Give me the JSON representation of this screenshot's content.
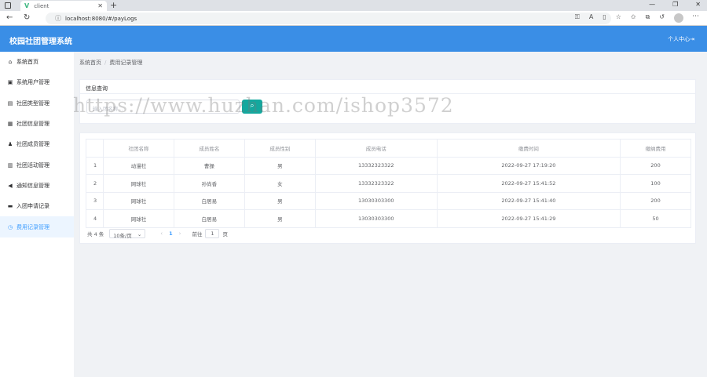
{
  "browser": {
    "tab_title": "client",
    "url": "localhost:8080/#/payLogs"
  },
  "header": {
    "title": "校园社团管理系统",
    "user_center": "个人中心"
  },
  "sidebar": {
    "items": [
      {
        "label": "系统首页",
        "icon": "home-icon"
      },
      {
        "label": "系统用户管理",
        "icon": "user-icon"
      },
      {
        "label": "社团类型管理",
        "icon": "list-icon"
      },
      {
        "label": "社团信息管理",
        "icon": "building-icon"
      },
      {
        "label": "社团成员管理",
        "icon": "users-icon"
      },
      {
        "label": "社团活动管理",
        "icon": "calendar-icon"
      },
      {
        "label": "通知信息管理",
        "icon": "bullhorn-icon"
      },
      {
        "label": "入团申请记录",
        "icon": "inbox-icon"
      },
      {
        "label": "费用记录管理",
        "icon": "clock-icon"
      }
    ]
  },
  "breadcrumb": {
    "home": "系统首页",
    "current": "费用记录管理"
  },
  "query": {
    "title": "信息查询",
    "placeholder": "输入团名称..."
  },
  "table": {
    "headers": [
      "",
      "社团名称",
      "成员姓名",
      "成员性别",
      "成员电话",
      "缴费时间",
      "缴纳费用"
    ],
    "rows": [
      [
        "1",
        "动漫社",
        "曹操",
        "男",
        "13332323322",
        "2022-09-27 17:19:20",
        "200"
      ],
      [
        "2",
        "网球社",
        "孙尚香",
        "女",
        "13332323322",
        "2022-09-27 15:41:52",
        "100"
      ],
      [
        "3",
        "网球社",
        "白居易",
        "男",
        "13030303300",
        "2022-09-27 15:41:40",
        "200"
      ],
      [
        "4",
        "网球社",
        "白居易",
        "男",
        "13030303300",
        "2022-09-27 15:41:29",
        "50"
      ]
    ]
  },
  "pagination": {
    "total": "共 4 条",
    "page_size": "10条/页",
    "current_page": "1",
    "goto_label": "前往",
    "goto_value": "1",
    "page_suffix": "页"
  },
  "watermark": "https://www.huzhan.com/ishop3572",
  "colors": {
    "header": "#3a8ee6",
    "search_button": "#13a89e",
    "active": "#409eff"
  }
}
